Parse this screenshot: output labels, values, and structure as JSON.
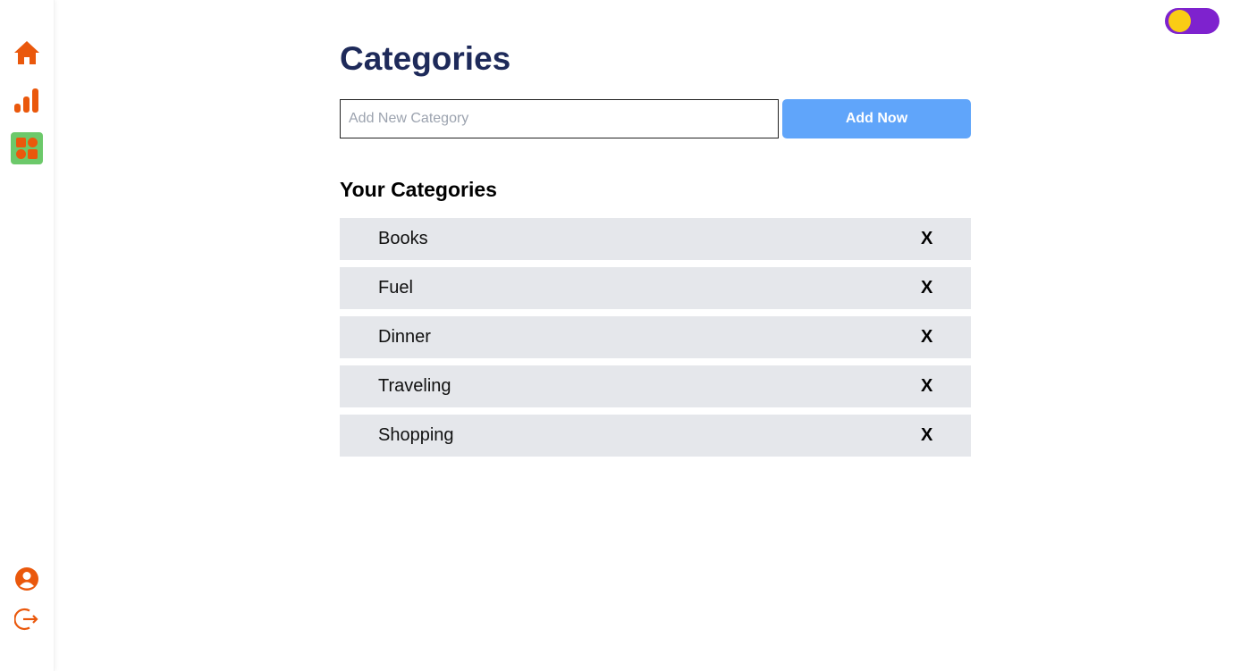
{
  "sidebar": {
    "nav": [
      {
        "name": "home-icon",
        "label": "Home"
      },
      {
        "name": "chart-icon",
        "label": "Stats"
      },
      {
        "name": "grid-icon",
        "label": "Categories",
        "active": true
      }
    ],
    "bottom": [
      {
        "name": "user-icon",
        "label": "Profile"
      },
      {
        "name": "logout-icon",
        "label": "Logout"
      }
    ],
    "icon_color": "#ea580c",
    "active_bg": "#6cc96a"
  },
  "theme_toggle": {
    "track_color": "#7e22ce",
    "knob_color": "#facc15"
  },
  "page": {
    "title": "Categories",
    "input_placeholder": "Add New Category",
    "input_value": "",
    "add_button_label": "Add Now",
    "list_heading": "Your Categories",
    "delete_label": "X"
  },
  "categories": [
    {
      "name": "Books"
    },
    {
      "name": "Fuel"
    },
    {
      "name": "Dinner"
    },
    {
      "name": "Traveling"
    },
    {
      "name": "Shopping"
    }
  ],
  "colors": {
    "title": "#1e2a5a",
    "button": "#60a5fa",
    "row_bg": "#e5e7eb"
  }
}
